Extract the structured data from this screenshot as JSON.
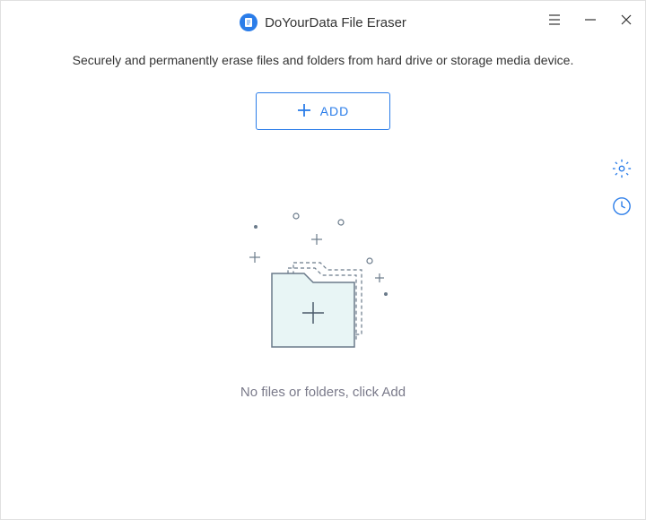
{
  "header": {
    "app_title": "DoYourData File Eraser"
  },
  "subtitle": "Securely and permanently erase files and folders from hard drive or storage media device.",
  "add_button": {
    "label": "ADD"
  },
  "empty_state": {
    "message": "No files or folders, click Add"
  },
  "colors": {
    "accent": "#2b7de9",
    "text_primary": "#333333",
    "text_muted": "#7a7a8a"
  }
}
